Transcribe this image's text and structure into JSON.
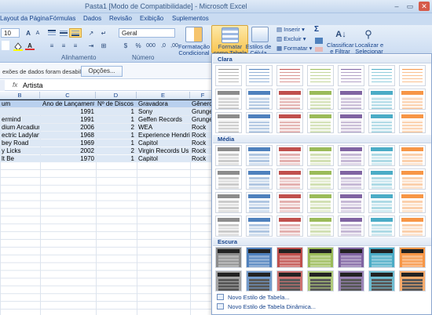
{
  "window": {
    "title": "Pasta1  [Modo de Compatibilidade] - Microsoft Excel",
    "controls": [
      "–",
      "▭",
      "✕"
    ]
  },
  "tabs": [
    "Layout da Página",
    "Fórmulas",
    "Dados",
    "Revisão",
    "Exibição",
    "Suplementos"
  ],
  "ribbon": {
    "font_size": "10",
    "font_grow": "A",
    "font_shrink": "A",
    "number_format": "Geral",
    "groups": {
      "alignment": "Alinhamento",
      "number": "Número"
    },
    "cond_format": "Formatação Condicional",
    "format_table": "Formatar como Tabela",
    "cell_styles": "Estilos de Célula",
    "insert": "Inserir",
    "delete": "Excluir",
    "format": "Formatar",
    "sort": "Classificar e Filtrar",
    "find": "Localizar e Selecionar",
    "sigma": "Σ"
  },
  "message_bar": {
    "text": "exões de dados foram desabilitadas",
    "options": "Opções..."
  },
  "formula_bar": {
    "fx": "fx",
    "content": "Artista"
  },
  "columns": [
    "B",
    "C",
    "D",
    "E",
    "F"
  ],
  "sheet": {
    "headers": [
      "um",
      "Ano de Lançamento",
      "Nº de Discos",
      "Gravadora",
      "Gênero"
    ],
    "rows": [
      [
        "",
        "1991",
        "1",
        "Sony",
        "Grunge"
      ],
      [
        "ermind",
        "1991",
        "1",
        "Geffen Records",
        "Grunge"
      ],
      [
        "dium Arcadium",
        "2006",
        "2",
        "WEA",
        "Rock"
      ],
      [
        "ectric Ladyland",
        "1968",
        "1",
        "Experience Hendrix",
        "Rock"
      ],
      [
        "bey Road",
        "1969",
        "1",
        "Capitol",
        "Rock"
      ],
      [
        "y Licks",
        "2002",
        "2",
        "Virgin Records Us",
        "Rock"
      ],
      [
        "lt Be",
        "1970",
        "1",
        "Capitol",
        "Rock"
      ]
    ]
  },
  "gallery": {
    "sections": [
      "Clara",
      "Média",
      "Escura"
    ],
    "new_style": "Novo Estilo de Tabela...",
    "new_pivot_style": "Novo Estilo de Tabela Dinâmica...",
    "colors": [
      "#8c8c8c",
      "#4f81bd",
      "#c0504d",
      "#9bbb59",
      "#8064a2",
      "#4bacc6",
      "#f79646"
    ]
  }
}
